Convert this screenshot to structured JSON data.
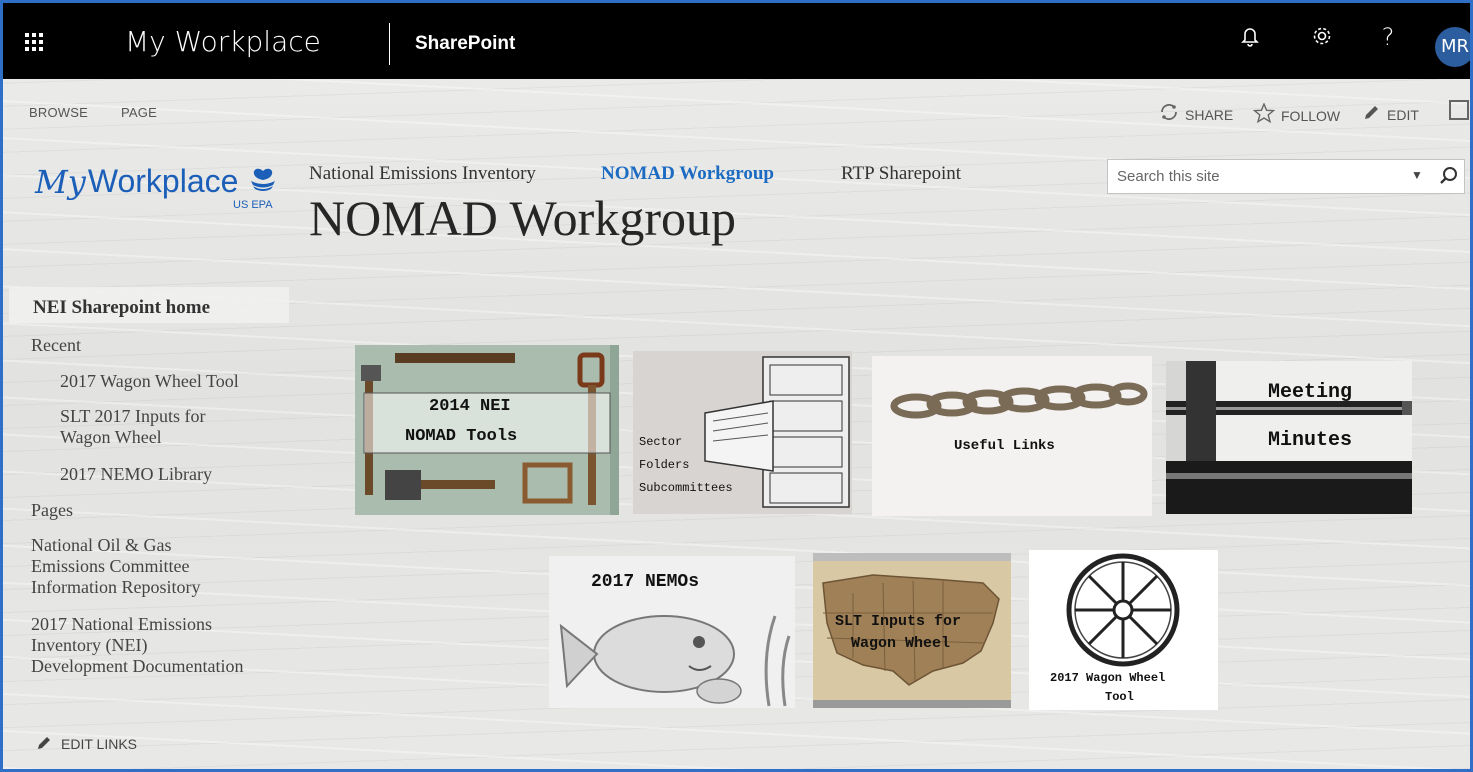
{
  "suite_bar": {
    "app_title": "My Workplace",
    "product": "SharePoint",
    "user_initials": "MR"
  },
  "ribbon": {
    "tabs": [
      "BROWSE",
      "PAGE"
    ],
    "actions": {
      "share": "SHARE",
      "follow": "FOLLOW",
      "edit": "EDIT"
    }
  },
  "logo": {
    "my": "My",
    "workplace": "Workplace",
    "agency": "US EPA"
  },
  "top_nav": [
    "National Emissions Inventory",
    "NOMAD Workgroup",
    "RTP Sharepoint"
  ],
  "page_title": "NOMAD Workgroup",
  "search": {
    "placeholder": "Search this site"
  },
  "left_nav": {
    "home": "NEI Sharepoint home",
    "recent": "Recent",
    "recent_items": [
      "2017 Wagon Wheel Tool",
      "SLT 2017 Inputs for Wagon Wheel",
      "2017 NEMO Library"
    ],
    "pages": "Pages",
    "links": [
      "National Oil & Gas Emissions Committee Information Repository",
      "2017 National Emissions Inventory (NEI) Development Documentation"
    ],
    "edit_links": "EDIT LINKS"
  },
  "tiles": {
    "nei_tools": {
      "line1": "2014 NEI",
      "line2": "NOMAD Tools"
    },
    "sector": {
      "line1": "Sector",
      "line2": "Folders",
      "line3": "Subcommittees"
    },
    "links": {
      "line1": "Useful Links"
    },
    "minutes": {
      "line1": "Meeting",
      "line2": "Minutes"
    },
    "nemos": {
      "line1": "2017 NEMOs"
    },
    "slt": {
      "line1": "SLT Inputs for",
      "line2": "Wagon Wheel"
    },
    "wagon": {
      "line1": "2017 Wagon Wheel",
      "line2": "Tool"
    }
  }
}
